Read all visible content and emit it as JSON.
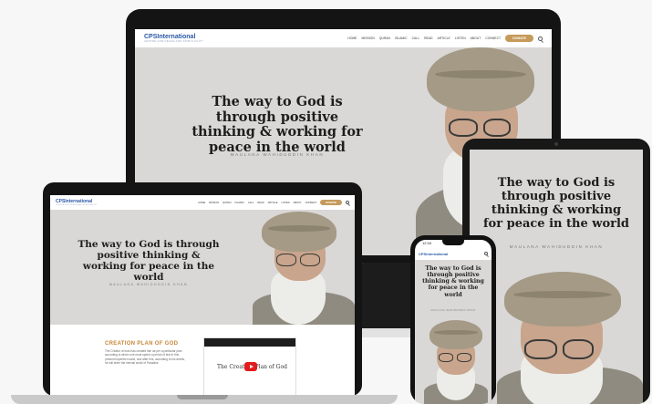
{
  "site": {
    "logo": "CPSInternational",
    "logo_sub": "CENTRE FOR PEACE AND SPIRITUALITY",
    "nav": [
      "HOME",
      "MISSION",
      "QURAN",
      "ISLAMIC",
      "CALL",
      "READ",
      "ARTICLE",
      "LISTEN",
      "ABOUT",
      "CONNECT"
    ],
    "donate": "DONATE",
    "quote_desktop": "The way to God is through positive thinking & working for peace in the world",
    "quote_tablet": "The way to God is through positive thinking & working for peace in the world",
    "byline": "MAULANA WAHIDUDDIN KHAN",
    "section_title": "CREATION PLAN OF GOD",
    "section_text": "The Creator of man has created him as per a particular plan according to which one must spend a period of test in this present imperfect world, and after this, according to his deeds, he will enter the eternal world of Paradise.",
    "video_title": "The Creation Plan of God"
  },
  "colors": {
    "accent": "#c59a5a",
    "logo_blue": "#2b58a6",
    "hero_bg": "#d9d8d6",
    "section_title": "#c9873a",
    "youtube_red": "#e21b1b"
  },
  "phone_status": {
    "time": "12:34"
  }
}
